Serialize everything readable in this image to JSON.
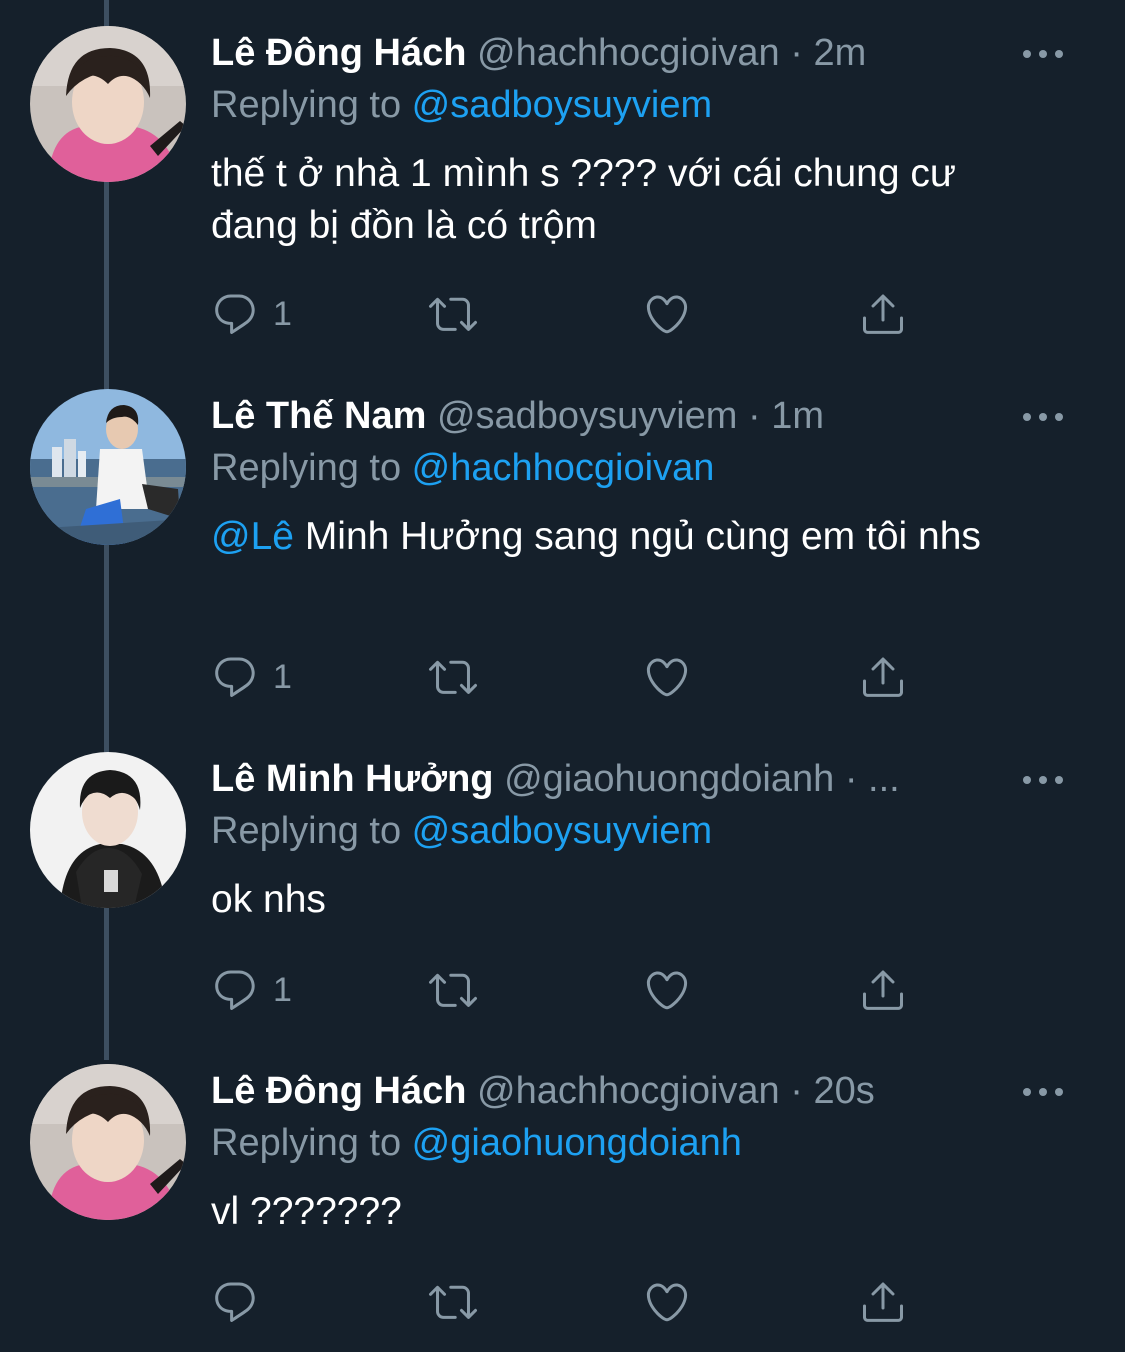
{
  "colors": {
    "background": "#15202b",
    "text_primary": "#ffffff",
    "text_secondary": "#8899a6",
    "link": "#1da1f2",
    "thread_line": "#3d4f61"
  },
  "tweets": [
    {
      "name": "Lê Đông Hách",
      "meta": "@hachhocgioivan · 2m",
      "replying_prefix": "Replying to ",
      "replying_to": "@sadboysuyviem",
      "mention": "",
      "text": "thế t ở nhà 1 mình s ???? với cái chung cư đang bị đồn là có trộm",
      "reply_count": "1",
      "avatar_icon": "avatar-pink-hoodie"
    },
    {
      "name": "Lê Thế Nam",
      "meta": "@sadboysuyviem · 1m",
      "replying_prefix": "Replying to ",
      "replying_to": "@hachhocgioivan",
      "mention": "@Lê",
      "text": " Minh Hưởng sang ngủ cùng em tôi nhs",
      "reply_count": "1",
      "avatar_icon": "avatar-boat-sea"
    },
    {
      "name": "Lê Minh Hưởng",
      "meta": "@giaohuongdoianh · ...",
      "replying_prefix": "Replying to ",
      "replying_to": "@sadboysuyviem",
      "mention": "",
      "text": "ok nhs",
      "reply_count": "1",
      "avatar_icon": "avatar-black-hoodie"
    },
    {
      "name": "Lê Đông Hách",
      "meta": "@hachhocgioivan · 20s",
      "replying_prefix": "Replying to ",
      "replying_to": "@giaohuongdoianh",
      "mention": "",
      "text": "vl ???????",
      "reply_count": "",
      "avatar_icon": "avatar-pink-hoodie"
    }
  ]
}
